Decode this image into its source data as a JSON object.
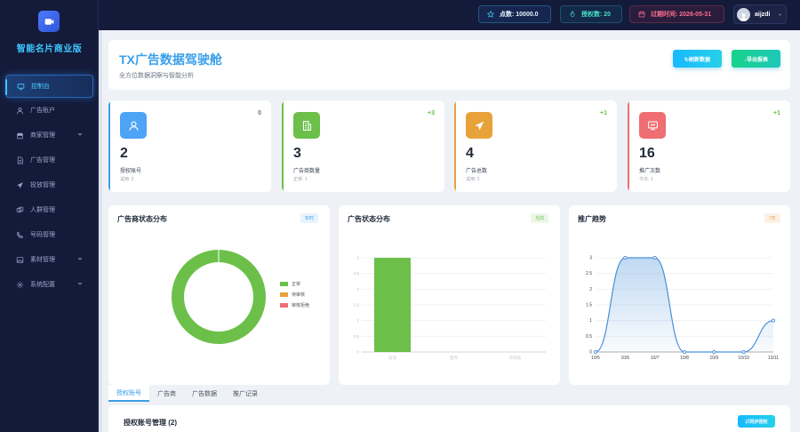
{
  "brand": {
    "name": "智能名片商业版"
  },
  "sidebar": {
    "items": [
      {
        "label": "控制台",
        "icon": "monitor-icon",
        "active": true
      },
      {
        "label": "广告账户",
        "icon": "user-icon"
      },
      {
        "label": "商家管理",
        "icon": "store-icon",
        "expandable": true
      },
      {
        "label": "广告管理",
        "icon": "document-icon"
      },
      {
        "label": "投放管理",
        "icon": "send-icon"
      },
      {
        "label": "人群管理",
        "icon": "users-icon"
      },
      {
        "label": "号码管理",
        "icon": "phone-icon"
      },
      {
        "label": "素材管理",
        "icon": "image-icon",
        "expandable": true
      },
      {
        "label": "系统配置",
        "icon": "gear-icon",
        "expandable": true
      }
    ]
  },
  "topbar": {
    "points": "点数: 10000.0",
    "auth": "授权数: 20",
    "expiry": "过期时间: 2026-05-31",
    "username": "aijzdi"
  },
  "hero": {
    "title": "TX广告数据驾驶舱",
    "subtitle": "全方位数据洞察与智能分析",
    "refresh_label": "↻刷新数据",
    "export_label": "↓导出报表"
  },
  "stats": [
    {
      "value": "2",
      "label": "授权账号",
      "note": "试用: 2",
      "delta": "0",
      "color": "#4da3f5"
    },
    {
      "value": "3",
      "label": "广告商数量",
      "note": "正常: 1",
      "delta": "+3",
      "color": "#6cc04a"
    },
    {
      "value": "4",
      "label": "广告总数",
      "note": "试用: 2",
      "delta": "+1",
      "color": "#e8a23a"
    },
    {
      "value": "16",
      "label": "推广次数",
      "note": "今日: 1",
      "delta": "+1",
      "color": "#ee6e73"
    }
  ],
  "cards": {
    "pie": {
      "title": "广告商状态分布",
      "badge": "实时"
    },
    "bar": {
      "title": "广告状态分布",
      "badge": "当前"
    },
    "line": {
      "title": "推广趋势",
      "badge": "7天"
    }
  },
  "chart_data": [
    {
      "type": "pie",
      "title": "广告商状态分布",
      "categories": [
        "正常",
        "待审核",
        "审核拒绝"
      ],
      "values": [
        3,
        0,
        0
      ],
      "colors": [
        "#6cc04a",
        "#e8a23a",
        "#ee6e73"
      ],
      "donut": true,
      "legend": "right"
    },
    {
      "type": "bar",
      "title": "广告状态分布",
      "categories": [
        "投放",
        "暂停",
        "待审核"
      ],
      "values": [
        3,
        0,
        0
      ],
      "ylim": [
        0,
        3
      ],
      "yticks": [
        "0",
        "0.5",
        "1",
        "1.5",
        "2",
        "2.5",
        "3"
      ],
      "color": "#6cc04a",
      "grid": true
    },
    {
      "type": "area",
      "title": "推广趋势",
      "categories": [
        "10/5",
        "10/6",
        "10/7",
        "10/8",
        "10/9",
        "10/10",
        "10/11"
      ],
      "values": [
        0,
        3,
        3,
        0,
        0,
        0,
        1
      ],
      "ylim": [
        0,
        3
      ],
      "yticks": [
        "0",
        "0.5",
        "1",
        "1.5",
        "2",
        "2.5",
        "3"
      ],
      "color": "#4a90d9",
      "grid": true
    }
  ],
  "tabs": [
    {
      "label": "授权账号",
      "active": true
    },
    {
      "label": "广告商"
    },
    {
      "label": "广告数据"
    },
    {
      "label": "推广记录"
    }
  ],
  "panel": {
    "title": "授权账号管理 (2)",
    "sync_label": "⇄同步授权"
  }
}
